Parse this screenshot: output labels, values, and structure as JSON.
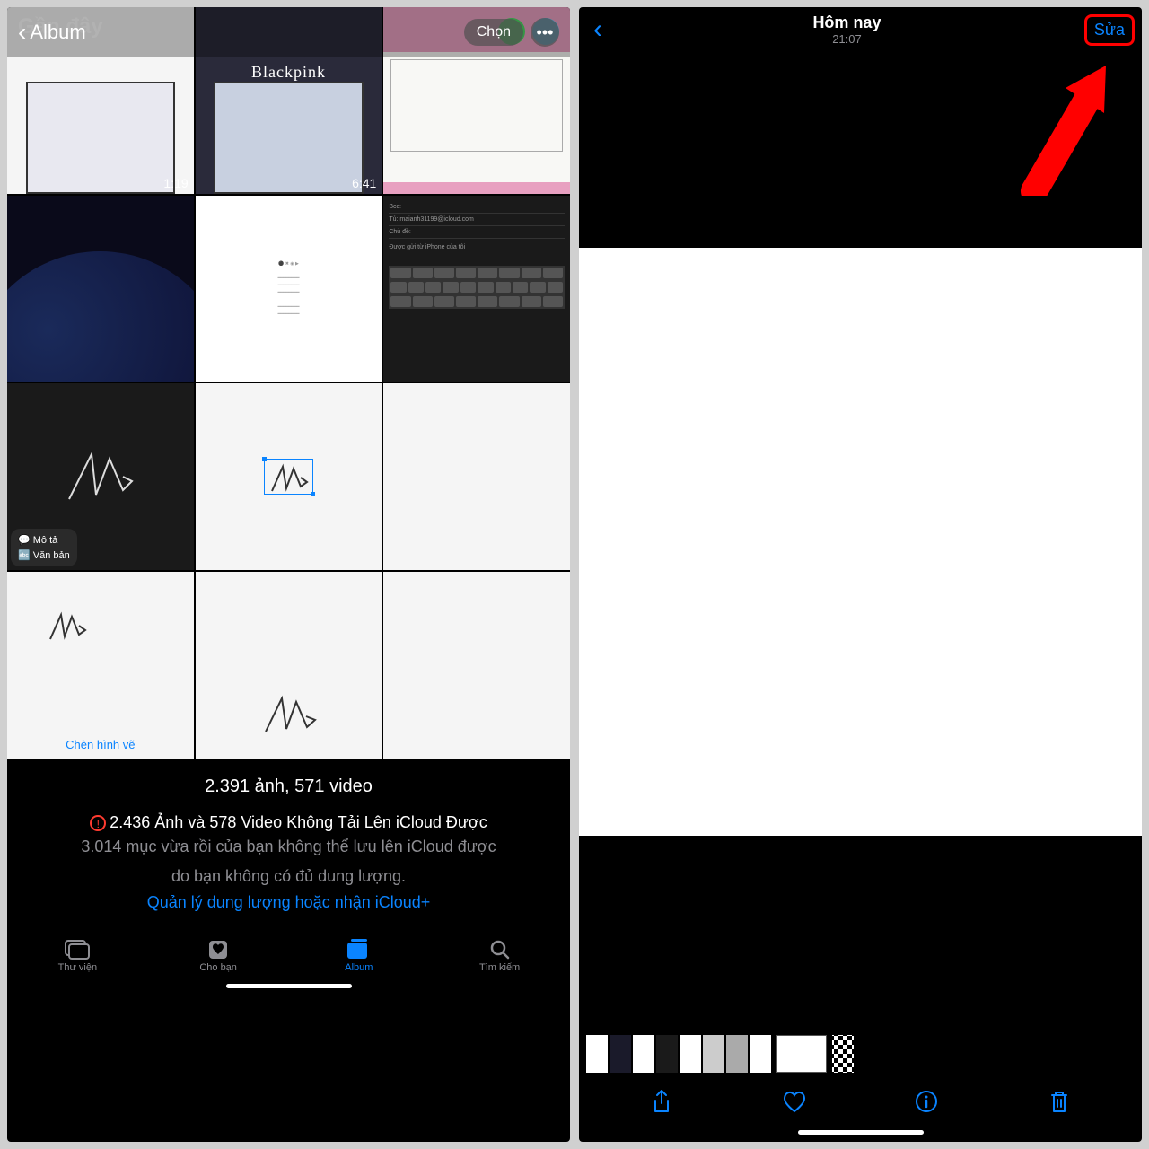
{
  "left": {
    "header": {
      "back_label": "Album",
      "select_label": "Chọn"
    },
    "recent_label": "Gần đây",
    "video_durations": [
      "1:19",
      "6:41"
    ],
    "menu": {
      "describe": "Mô tả",
      "text": "Văn bản"
    },
    "insert_drawing": "Chèn hình vẽ",
    "blackpink": "Blackpink",
    "email_to": "maianh31199@icloud.com",
    "email_sent": "Được gửi từ iPhone của tôi",
    "email_bcc": "Bcc:",
    "email_tu": "Tủ:",
    "email_subject": "Chủ đề:",
    "counts": "2.391 ảnh, 571 video",
    "error_line": "2.436 Ảnh và 578 Video Không Tải Lên iCloud Được",
    "sub1": "3.014 mục vừa rồi của bạn không thể lưu lên iCloud được",
    "sub2": "do bạn không có đủ dung lượng.",
    "link": "Quản lý dung lượng hoặc nhận iCloud+",
    "tabs": {
      "library": "Thư viện",
      "for_you": "Cho bạn",
      "album": "Album",
      "search": "Tìm kiếm"
    }
  },
  "right": {
    "title": "Hôm nay",
    "time": "21:07",
    "edit": "Sửa"
  }
}
